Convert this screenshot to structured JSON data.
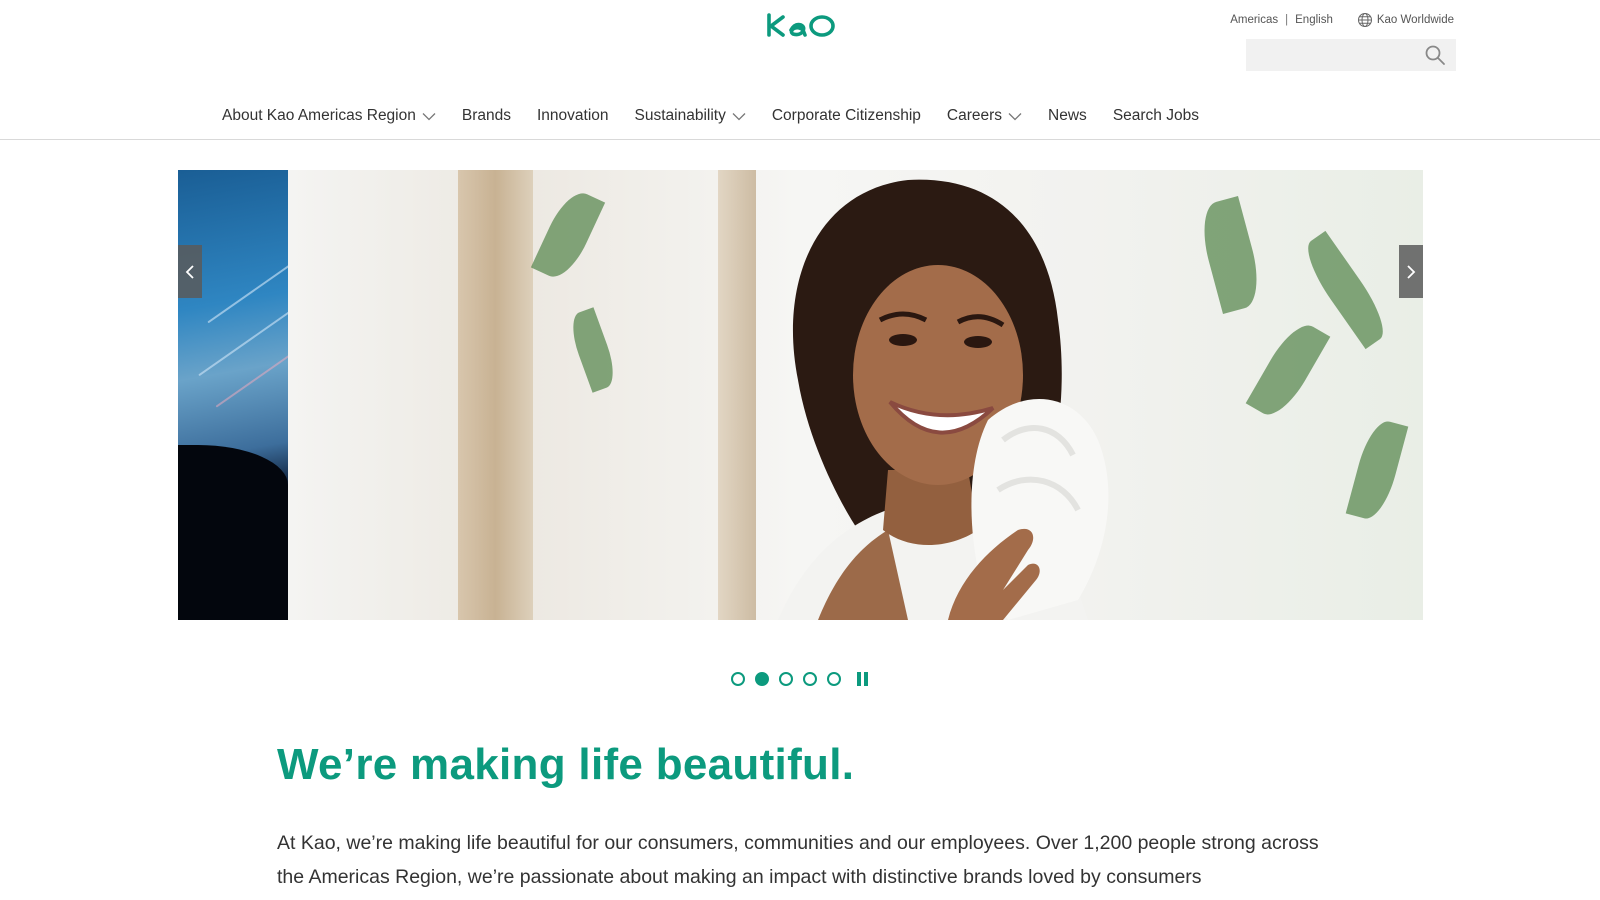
{
  "header": {
    "logo_text": "Kao",
    "region": "Americas",
    "language": "English",
    "worldwide": "Kao Worldwide",
    "search_placeholder": ""
  },
  "nav": {
    "items": [
      {
        "label": "About Kao Americas Region",
        "dropdown": true
      },
      {
        "label": "Brands",
        "dropdown": false
      },
      {
        "label": "Innovation",
        "dropdown": false
      },
      {
        "label": "Sustainability",
        "dropdown": true
      },
      {
        "label": "Corporate Citizenship",
        "dropdown": false
      },
      {
        "label": "Careers",
        "dropdown": true
      },
      {
        "label": "News",
        "dropdown": false
      },
      {
        "label": "Search Jobs",
        "dropdown": false
      }
    ]
  },
  "carousel": {
    "slide_count": 5,
    "active_index": 1,
    "paused": false
  },
  "content": {
    "headline": "We’re making life beautiful.",
    "intro": "At Kao, we’re making life beautiful for our consumers, communities and our employees. Over 1,200 people strong across the Americas Region, we’re passionate about making an impact with distinctive brands loved by consumers"
  },
  "colors": {
    "brand": "#0c9a7e",
    "text": "#333333",
    "search_bg": "#f1f1f1"
  },
  "icons": [
    "globe-icon",
    "search-icon",
    "chevron-down-icon",
    "chevron-left-icon",
    "chevron-right-icon",
    "pause-icon"
  ]
}
